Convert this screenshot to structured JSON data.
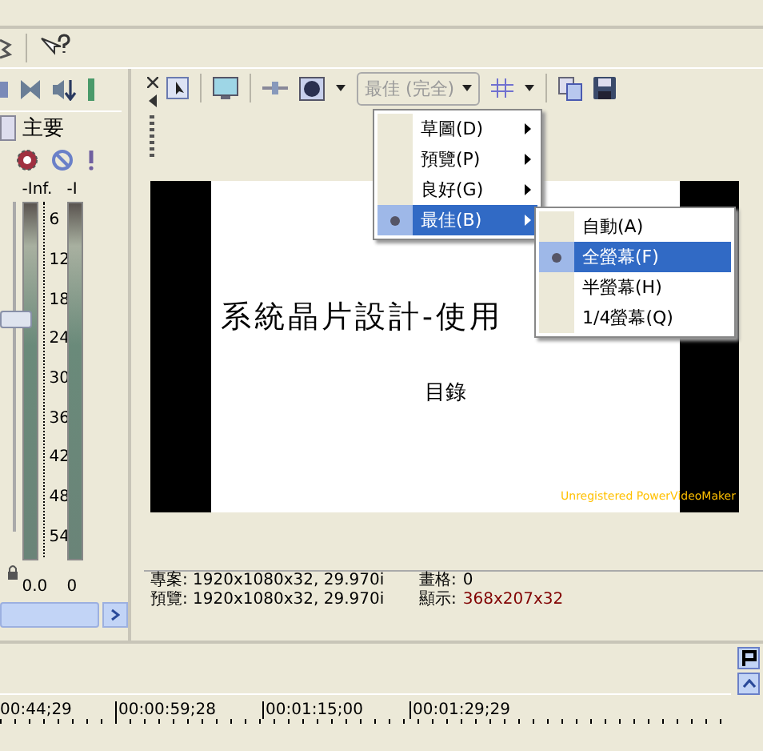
{
  "mixer": {
    "bus_label": "主要",
    "fader": {
      "level": 0.64
    },
    "meters": [
      {
        "peak": "-Inf.",
        "reading": "0.0"
      },
      {
        "peak": "-I",
        "reading": "0"
      }
    ],
    "scale": [
      "6",
      "12",
      "18",
      "24",
      "30",
      "36",
      "42",
      "48",
      "54"
    ]
  },
  "preview_toolbar": {
    "quality_dropdown": "最佳 (完全)"
  },
  "quality_menu": [
    {
      "label": "草圖(D)",
      "selected": false
    },
    {
      "label": "預覽(P)",
      "selected": false
    },
    {
      "label": "良好(G)",
      "selected": false
    },
    {
      "label": "最佳(B)",
      "selected": true
    }
  ],
  "quality_submenu": [
    {
      "label": "自動(A)",
      "selected": false
    },
    {
      "label": "全螢幕(F)",
      "selected": true
    },
    {
      "label": "半螢幕(H)",
      "selected": false
    },
    {
      "label": "1/4螢幕(Q)",
      "selected": false
    }
  ],
  "preview": {
    "title": "系統晶片設計-使用",
    "subtitle": "目錄",
    "watermark": "Unregistered PowerVideoMaker"
  },
  "info": [
    {
      "label": "專案: 1920x1080x32, 29.970i",
      "label_2": "畫格:",
      "value_2": "0",
      "highlight": false
    },
    {
      "label": "預覽: 1920x1080x32, 29.970i",
      "label_2": "顯示:",
      "value_2": "368x207x32",
      "highlight": true
    }
  ],
  "timeline": {
    "ticks": [
      "00:44;29",
      "00:00:59;28",
      "00:01:15;00",
      "00:01:29;29"
    ]
  }
}
